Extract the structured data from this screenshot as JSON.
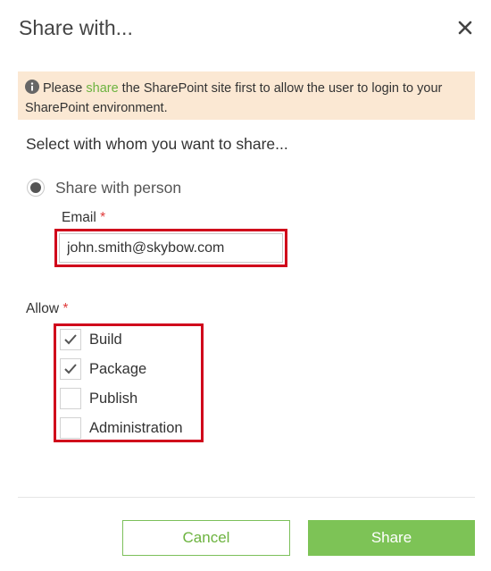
{
  "dialog": {
    "title": "Share with...",
    "close_icon": "close-icon"
  },
  "info": {
    "icon": "info-icon",
    "prefix": "Please ",
    "link": "share",
    "suffix": " the SharePoint site first to allow the user to login to your SharePoint environment."
  },
  "subtitle": "Select with whom you want to share...",
  "share_option": {
    "label": "Share with person",
    "selected": true
  },
  "email": {
    "label": "Email",
    "required_mark": "*",
    "value": "john.smith@skybow.com"
  },
  "allow": {
    "label": "Allow",
    "required_mark": "*",
    "options": [
      {
        "label": "Build",
        "checked": true
      },
      {
        "label": "Package",
        "checked": true
      },
      {
        "label": "Publish",
        "checked": false
      },
      {
        "label": "Administration",
        "checked": false
      }
    ]
  },
  "buttons": {
    "cancel": "Cancel",
    "share": "Share"
  },
  "colors": {
    "accent": "#7dc356",
    "link": "#6cb33f",
    "highlight": "#d0021b",
    "banner": "#fbe8d3",
    "required": "#e03a3a"
  }
}
